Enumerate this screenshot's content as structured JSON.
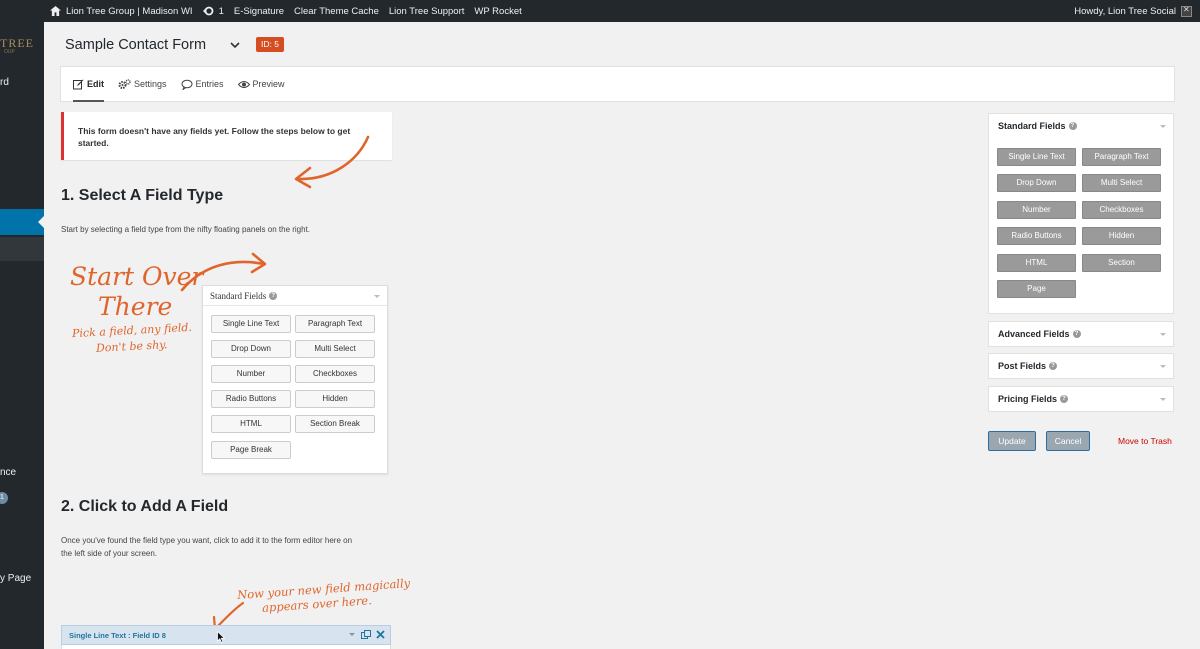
{
  "adminbar": {
    "site_name": "Lion Tree Group | Madison WI",
    "updates_count": "1",
    "items": [
      "E-Signature",
      "Clear Theme Cache",
      "Lion Tree Support",
      "WP Rocket"
    ],
    "greeting": "Howdy, Lion Tree Social"
  },
  "sidebar": {
    "logo": "TREE",
    "logo_sub": "OUP",
    "fragments": {
      "dashboard": "rd",
      "appearance": "nce",
      "comments_badge": "1",
      "my_page": "y Page"
    }
  },
  "header": {
    "form_title": "Sample Contact Form",
    "id_badge": "ID: 5"
  },
  "tabs": [
    {
      "label": "Edit",
      "icon": "edit-icon"
    },
    {
      "label": "Settings",
      "icon": "gear-icon"
    },
    {
      "label": "Entries",
      "icon": "comment-icon"
    },
    {
      "label": "Preview",
      "icon": "eye-icon"
    }
  ],
  "notice": {
    "text": "This form doesn't have any fields yet. Follow the steps below to get started."
  },
  "step1": {
    "heading": "1. Select A Field Type",
    "text": "Start by selecting a field type from the nifty floating panels on the right."
  },
  "step2": {
    "heading": "2. Click to Add A Field",
    "text_line1": "Once you've found the field type you want, click to add it to the form editor here on",
    "text_line2": "the left side of your screen."
  },
  "handwritten": {
    "start_over_1": "Start Over",
    "start_over_2": "There",
    "pick_1": "Pick a field, any field.",
    "pick_2": "Don't be shy.",
    "appears_1": "Now your new field magically",
    "appears_2": "appears over here."
  },
  "example_panel": {
    "title": "Standard Fields",
    "buttons": [
      "Single Line Text",
      "Paragraph Text",
      "Drop Down",
      "Multi Select",
      "Number",
      "Checkboxes",
      "Radio Buttons",
      "Hidden",
      "HTML",
      "Section Break",
      "Page Break"
    ]
  },
  "field_example": {
    "label": "Single Line Text : Field ID 8"
  },
  "right_panels": {
    "standard": {
      "title": "Standard Fields",
      "buttons": [
        "Single Line Text",
        "Paragraph Text",
        "Drop Down",
        "Multi Select",
        "Number",
        "Checkboxes",
        "Radio Buttons",
        "Hidden",
        "HTML",
        "Section",
        "Page"
      ]
    },
    "advanced": {
      "title": "Advanced Fields"
    },
    "post": {
      "title": "Post Fields"
    },
    "pricing": {
      "title": "Pricing Fields"
    }
  },
  "actions": {
    "update": "Update",
    "cancel": "Cancel",
    "trash": "Move to Trash"
  },
  "colors": {
    "adminbar_bg": "#23282d",
    "accent_orange": "#e0652c",
    "id_badge_bg": "#d54e21",
    "notice_border": "#dc3232",
    "active_menu": "#0073aa",
    "field_button_gray": "#9a9a9a"
  }
}
